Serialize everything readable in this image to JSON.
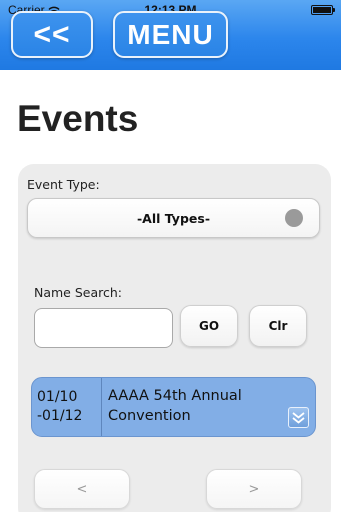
{
  "status_bar": {
    "carrier": "Carrier",
    "time": "12:13 PM",
    "wifi_icon": "wifi-icon",
    "battery_icon": "battery-icon"
  },
  "nav": {
    "back_label": "<<",
    "menu_label": "MENU"
  },
  "page": {
    "title": "Events"
  },
  "filters": {
    "event_type_label": "Event Type:",
    "event_type_value": "-All Types-",
    "name_search_label": "Name Search:",
    "name_search_value": "",
    "go_label": "GO",
    "clear_label": "Clr"
  },
  "events": [
    {
      "date_start": "01/10",
      "date_end": "-01/12",
      "name": "AAAA 54th Annual\nConvention",
      "expand_icon": "double-chevron-down-icon"
    }
  ],
  "pagination": {
    "prev_label": "<",
    "next_label": ">"
  },
  "colors": {
    "nav_bar": "#2c86ec",
    "event_row": "#82aee6",
    "panel": "#ececec"
  }
}
